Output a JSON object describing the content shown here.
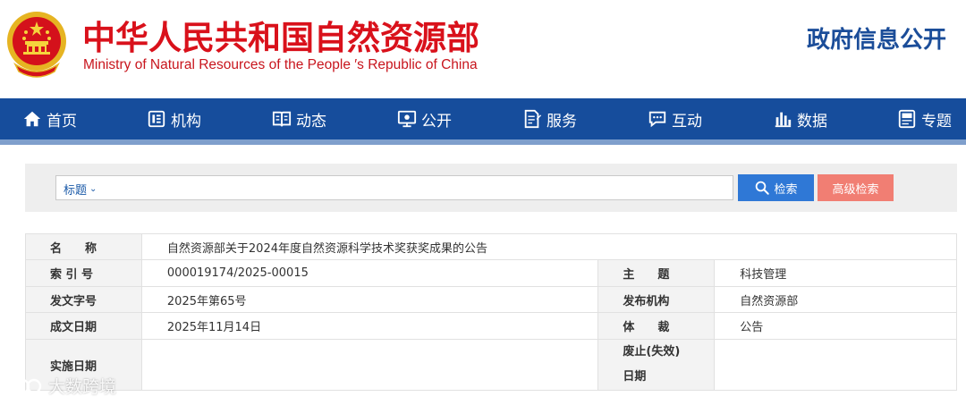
{
  "header": {
    "title_cn": "中华人民共和国自然资源部",
    "title_en": "Ministry of Natural Resources of the People ′s Republic of China",
    "gov_open": "政府信息公开"
  },
  "nav": {
    "items": [
      {
        "label": "首页",
        "icon": "home-icon"
      },
      {
        "label": "机构",
        "icon": "org-icon"
      },
      {
        "label": "动态",
        "icon": "book-icon"
      },
      {
        "label": "公开",
        "icon": "monitor-icon"
      },
      {
        "label": "服务",
        "icon": "document-edit-icon"
      },
      {
        "label": "互动",
        "icon": "chat-icon"
      },
      {
        "label": "数据",
        "icon": "bar-chart-icon"
      },
      {
        "label": "专题",
        "icon": "topic-icon"
      }
    ]
  },
  "search": {
    "type_label": "标题",
    "value": "",
    "search_button": "检索",
    "advanced_button": "高级检索"
  },
  "info": {
    "name_label": "名　　称",
    "name_value": "自然资源部关于2024年度自然资源科学技术奖获奖成果的公告",
    "index_label": "索 引 号",
    "index_value": "000019174/2025-00015",
    "subject_label": "主　　题",
    "subject_value": "科技管理",
    "doc_no_label": "发文字号",
    "doc_no_value": "2025年第65号",
    "issuer_label": "发布机构",
    "issuer_value": "自然资源部",
    "date_label": "成文日期",
    "date_value": "2025年11月14日",
    "genre_label": "体　　裁",
    "genre_value": "公告",
    "effective_label": "实施日期",
    "effective_value": "",
    "expire_label_1": "废止(失效)",
    "expire_label_2": "日期",
    "expire_value": ""
  },
  "watermark": {
    "text": "大数跨境"
  },
  "colors": {
    "brand_red": "#d9111b",
    "nav_blue": "#164d9c",
    "search_blue": "#2f78d6",
    "advanced_red": "#f17e73"
  }
}
